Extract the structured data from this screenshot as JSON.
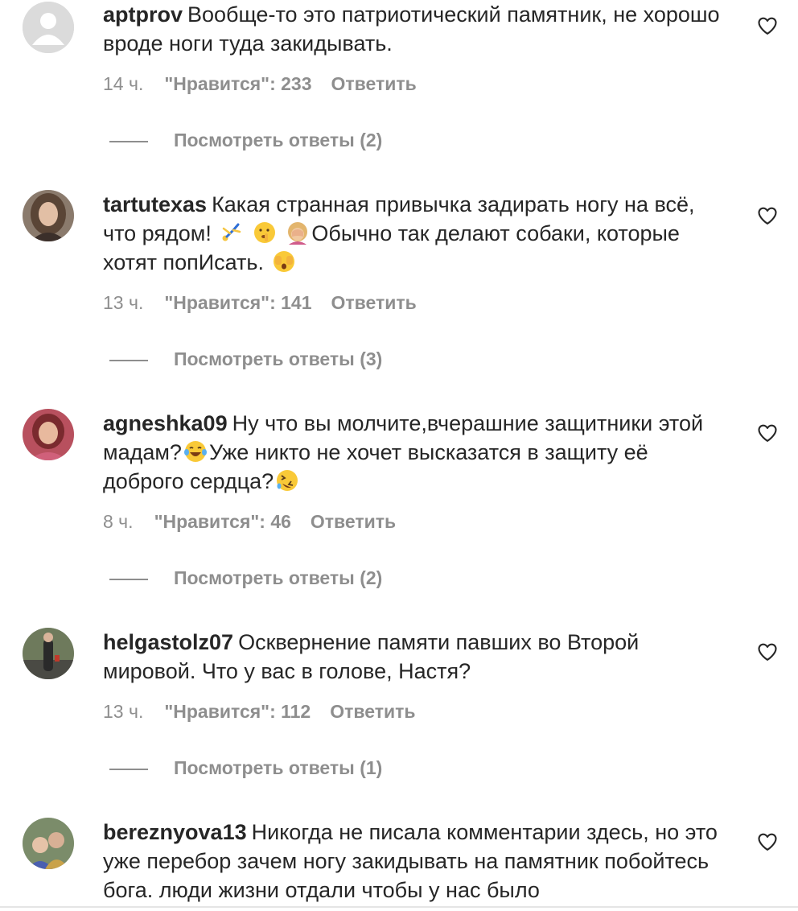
{
  "comments": [
    {
      "username": "aptprov",
      "text_parts": [
        "Вообще-то это патриотический памятник, не хорошо вроде ноги туда закидывать."
      ],
      "time": "14 ч.",
      "likes": "\"Нравится\": 233",
      "reply": "Ответить",
      "view_replies": "Посмотреть ответы (2)"
    },
    {
      "username": "tartutexas",
      "text_parts": [
        "Какая странная привычка задирать ногу на всё, что рядом! ",
        " ",
        " ",
        "Обычно так делают собаки, которые хотят попИсать. ",
        ""
      ],
      "emojis": [
        "gymnast-emoji",
        "shushing-face-emoji",
        "facepalm-emoji",
        "face-with-hands-over-eyes-emoji"
      ],
      "time": "13 ч.",
      "likes": "\"Нравится\": 141",
      "reply": "Ответить",
      "view_replies": "Посмотреть ответы (3)"
    },
    {
      "username": "agneshka09",
      "text_parts": [
        "Ну что вы молчите,вчерашние защитники этой мадам?",
        "Уже никто не хочет высказатся в защиту её доброго сердца?",
        ""
      ],
      "emojis": [
        "tears-of-joy-emoji",
        "rolling-laughing-emoji"
      ],
      "time": "8 ч.",
      "likes": "\"Нравится\": 46",
      "reply": "Ответить",
      "view_replies": "Посмотреть ответы (2)"
    },
    {
      "username": "helgastolz07",
      "text_parts": [
        "Осквернение памяти павших во Второй мировой. Что у вас в голове, Настя?"
      ],
      "time": "13 ч.",
      "likes": "\"Нравится\": 112",
      "reply": "Ответить",
      "view_replies": "Посмотреть ответы (1)"
    },
    {
      "username": "bereznyova13",
      "text_parts": [
        "Никогда не писала комментарии здесь, но это уже перебор зачем ногу закидывать на памятник побойтесь бога. люди жизни отдали чтобы у нас было"
      ]
    }
  ],
  "icons": {
    "like": "heart-outline-icon"
  },
  "colors": {
    "text": "#262626",
    "secondary": "#8e8e8e"
  }
}
